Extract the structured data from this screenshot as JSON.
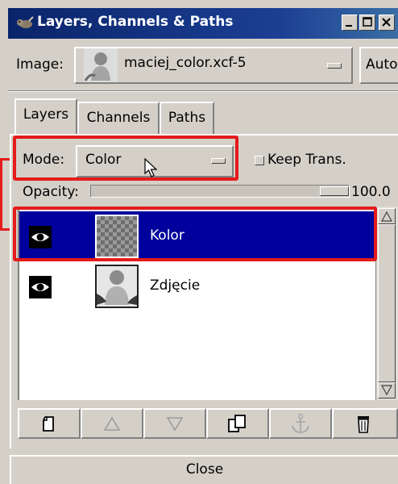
{
  "window": {
    "title": "Layers, Channels & Paths",
    "titlebar_color": "#0a246a"
  },
  "image_row": {
    "label": "Image:",
    "selected_image": "maciej_color.xcf-5",
    "auto_label": "Auto"
  },
  "tabs": [
    {
      "label": "Layers",
      "active": true
    },
    {
      "label": "Channels",
      "active": false
    },
    {
      "label": "Paths",
      "active": false
    }
  ],
  "mode": {
    "label": "Mode:",
    "value": "Color"
  },
  "keep_trans": {
    "label": "Keep Trans.",
    "checked": false
  },
  "opacity": {
    "label": "Opacity:",
    "value_text": "100.0",
    "level_percent": 100
  },
  "layers": [
    {
      "name": "Kolor",
      "visible": true,
      "selected": true,
      "thumbnail": "transparent-checker"
    },
    {
      "name": "Zdjęcie",
      "visible": true,
      "selected": false,
      "thumbnail": "baby-photo"
    }
  ],
  "toolbar": {
    "buttons": [
      {
        "icon": "new-layer-icon",
        "enabled": true
      },
      {
        "icon": "raise-layer-icon",
        "enabled": false
      },
      {
        "icon": "lower-layer-icon",
        "enabled": false
      },
      {
        "icon": "duplicate-layer-icon",
        "enabled": true
      },
      {
        "icon": "anchor-layer-icon",
        "enabled": false
      },
      {
        "icon": "delete-layer-icon",
        "enabled": true
      }
    ]
  },
  "close_label": "Close",
  "colors": {
    "selection": "#00009c",
    "highlight": "#e51b1b",
    "panel": "#d4d0c8"
  }
}
